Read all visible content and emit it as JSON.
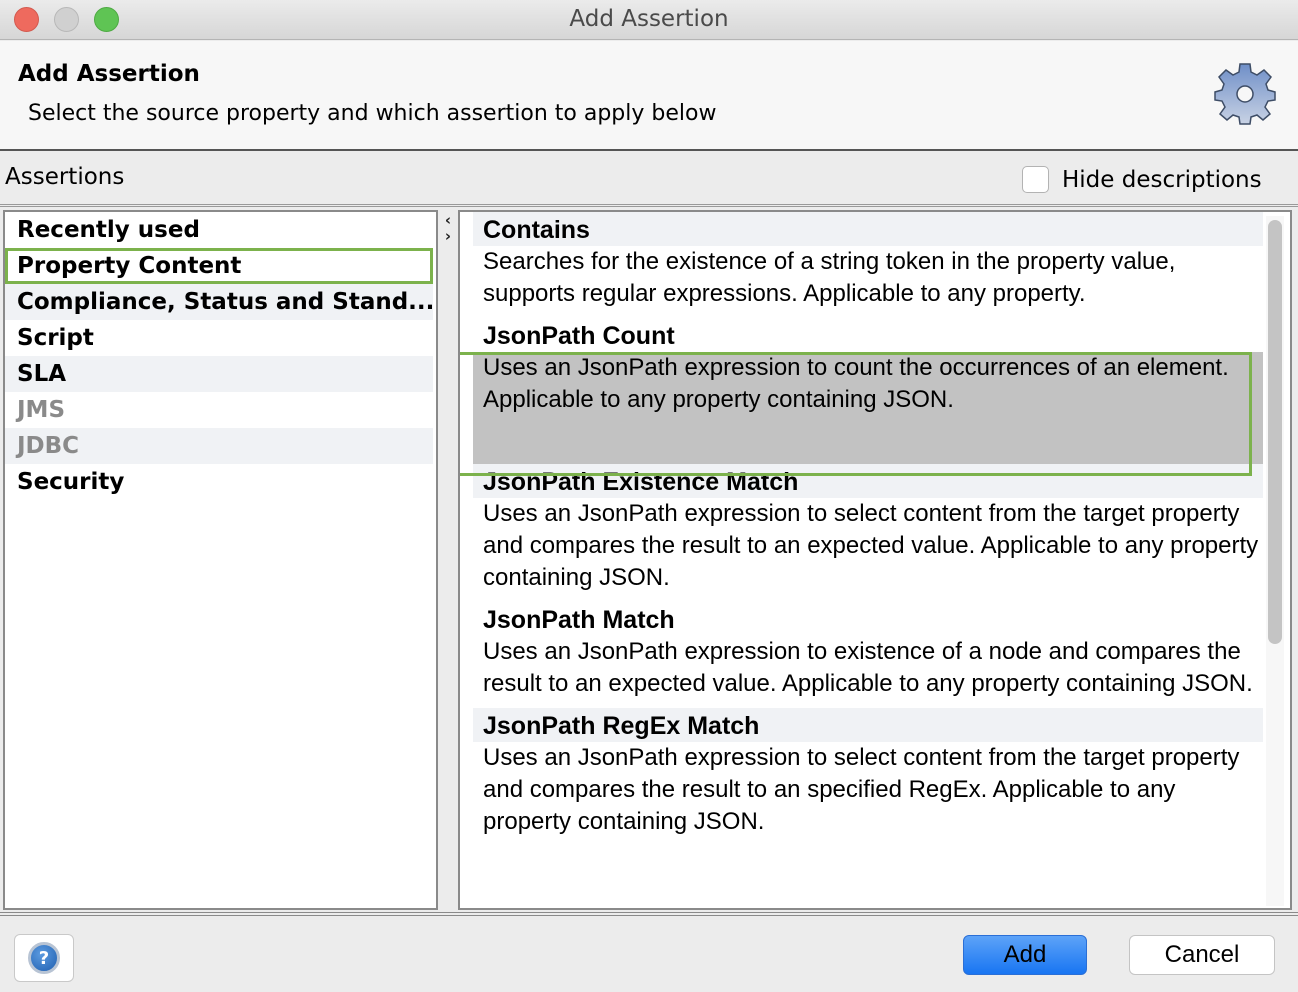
{
  "window": {
    "title": "Add Assertion"
  },
  "header": {
    "title": "Add Assertion",
    "subtitle": "Select the source property and which assertion to apply below",
    "icon": "gear-icon"
  },
  "assertions_label": "Assertions",
  "hide_descriptions": {
    "label": "Hide descriptions",
    "checked": false
  },
  "categories": [
    {
      "label": "Recently used",
      "enabled": true,
      "selected": false
    },
    {
      "label": "Property Content",
      "enabled": true,
      "selected": true
    },
    {
      "label": "Compliance, Status and Stand...",
      "enabled": true,
      "selected": false
    },
    {
      "label": "Script",
      "enabled": true,
      "selected": false
    },
    {
      "label": "SLA",
      "enabled": true,
      "selected": false
    },
    {
      "label": "JMS",
      "enabled": false,
      "selected": false
    },
    {
      "label": "JDBC",
      "enabled": false,
      "selected": false
    },
    {
      "label": "Security",
      "enabled": true,
      "selected": false
    }
  ],
  "divider": {
    "collapse_left": "‹",
    "expand_right": "›"
  },
  "assertion_list": [
    {
      "title": "Contains",
      "description": "Searches for the existence of a string token in the property value, supports regular expressions. Applicable to any property.",
      "selected": false
    },
    {
      "title": "JsonPath Count",
      "description": "Uses an JsonPath expression to count the occurrences of an element. Applicable to any property containing JSON.",
      "selected": true
    },
    {
      "title": "JsonPath Existence Match",
      "description": "Uses an JsonPath expression to select content from the target property and compares the result to an expected value. Applicable to any property containing JSON.",
      "selected": false
    },
    {
      "title": "JsonPath Match",
      "description": "Uses an JsonPath expression to existence of a node and compares the result to an expected value. Applicable to any property containing JSON.",
      "selected": false
    },
    {
      "title": "JsonPath RegEx Match",
      "description": "Uses an JsonPath expression to select content from the target property and compares the result to an specified RegEx. Applicable to any property containing JSON.",
      "selected": false
    }
  ],
  "footer": {
    "help_icon": "?",
    "add_label": "Add",
    "cancel_label": "Cancel"
  },
  "colors": {
    "highlight_border": "#7cb24c",
    "selected_bg": "#c2c2c2",
    "primary_button": "#1875f2"
  }
}
